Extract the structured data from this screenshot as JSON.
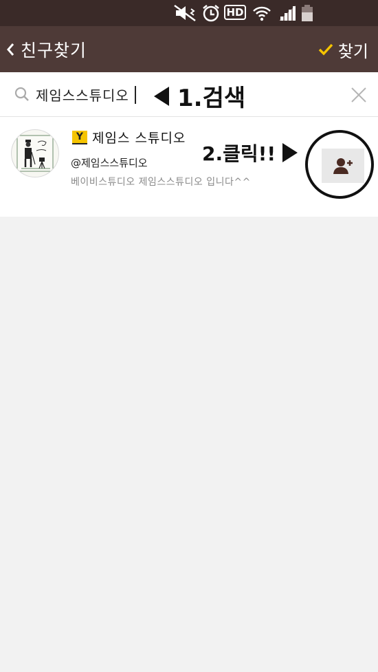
{
  "header": {
    "title": "친구찾기",
    "find_label": "찾기"
  },
  "search": {
    "value": "제임스스튜디오",
    "annotation": "1.검색"
  },
  "result": {
    "badge": "Y",
    "name": "제임스 스튜디오",
    "id": "@제임스스튜디오",
    "description": "베이비스튜디오 제임스스튜디오 입니다^^",
    "annotation": "2.클릭!!"
  },
  "status_bar": {
    "icons": [
      "mute-vibrate-icon",
      "alarm-icon",
      "hd-icon",
      "wifi-icon",
      "signal-icon",
      "battery-icon"
    ],
    "hd_text": "HD"
  },
  "colors": {
    "status_bar": "#3a2a28",
    "header": "#4e3a37",
    "check": "#f5c400",
    "badge": "#f5c400",
    "background": "#f2f2f2"
  }
}
